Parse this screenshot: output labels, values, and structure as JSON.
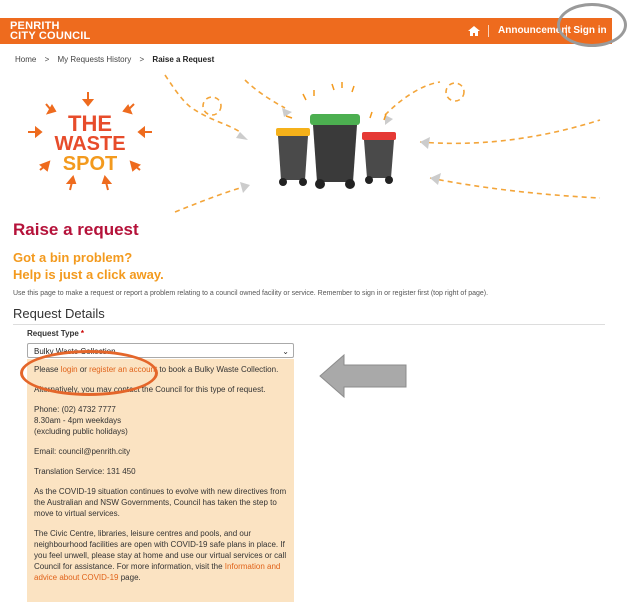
{
  "header": {
    "logo_line1": "PENRITH",
    "logo_line2": "CITY COUNCIL",
    "announcements_label": "Announcement",
    "sign_in_label": "Sign in",
    "brand_color": "#ee6b1e"
  },
  "breadcrumb": {
    "items": [
      "Home",
      "My Requests History",
      "Raise a Request"
    ],
    "separator": ">"
  },
  "banner": {
    "logo_line1": "THE",
    "logo_line2": "WASTE",
    "logo_line3": "SPOT"
  },
  "page": {
    "title": "Raise a request",
    "tagline1": "Got a bin problem?",
    "tagline2": "Help is just a click away.",
    "intro": "Use this page to make a request or report a problem relating to a council owned facility or service. Remember to sign in or register first (top right of page).",
    "section_title": "Request Details"
  },
  "form": {
    "request_type_label": "Request Type",
    "required_mark": "*",
    "request_type_value": "Bulky Waste Collection"
  },
  "info": {
    "please": "Please ",
    "login": "login",
    "or": " or ",
    "register": "register an account",
    "to_book": " to book a Bulky Waste Collection.",
    "alternatively": "Alternatively, you may contact the Council for this type of request.",
    "phone": "Phone: (02) 4732 7777",
    "hours": "8.30am - 4pm weekdays",
    "holidays": "(excluding public holidays)",
    "email": "Email: council@penrith.city",
    "translation": "Translation Service: 131 450",
    "covid1": "As the COVID-19 situation continues to evolve with new directives from the Australian and NSW Governments, Council has taken the step to move to virtual services.",
    "covid2_pre": "The Civic Centre, libraries, leisure centres and pools, and our neighbourhood facilities are open with COVID-19 safe plans in place. If you feel unwell, please stay at home and use our virtual services or call Council for assistance. For more information, visit the ",
    "covid2_link": "Information and advice about COVID-19",
    "covid2_post": " page."
  }
}
